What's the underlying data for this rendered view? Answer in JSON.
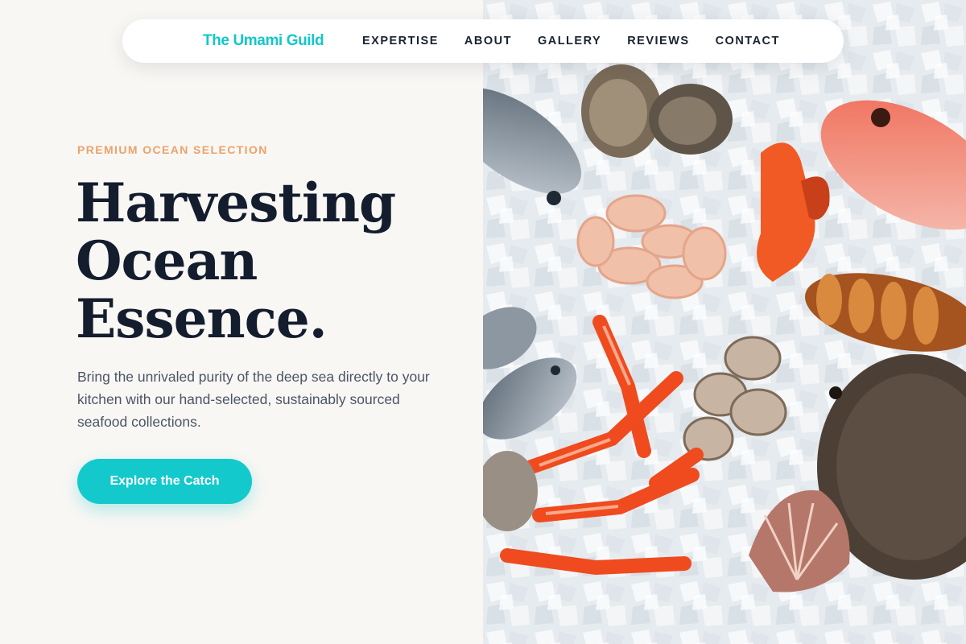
{
  "brand": {
    "name": "The Umami Guild"
  },
  "nav": {
    "items": [
      {
        "label": "EXPERTISE"
      },
      {
        "label": "ABOUT"
      },
      {
        "label": "GALLERY"
      },
      {
        "label": "REVIEWS"
      },
      {
        "label": "CONTACT"
      }
    ]
  },
  "hero": {
    "eyebrow": "PREMIUM OCEAN SELECTION",
    "headline": [
      "Harvesting",
      "Ocean",
      "Essence."
    ],
    "description": "Bring the unrivaled purity of the deep sea directly to your kitchen with our hand-selected, sustainably sourced seafood collections.",
    "cta_label": "Explore the Catch"
  },
  "colors": {
    "accent": "#14c9cc",
    "eyebrow": "#eaa36a",
    "heading": "#141d2e",
    "background": "#f9f7f4"
  }
}
